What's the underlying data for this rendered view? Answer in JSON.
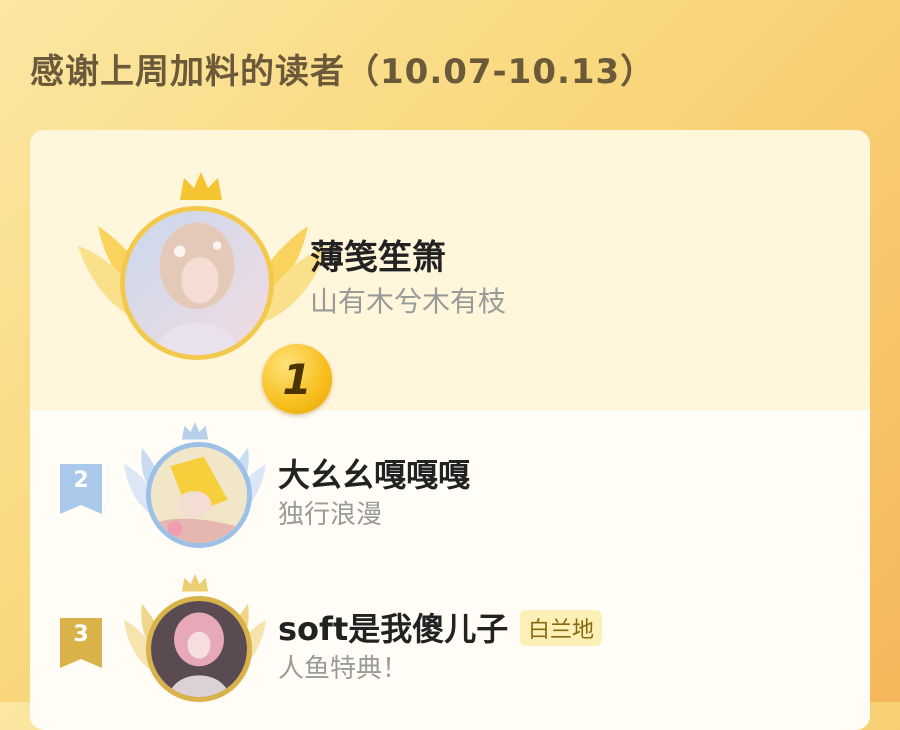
{
  "header": {
    "title": "感谢上周加料的读者（10.07-10.13）"
  },
  "ranking": [
    {
      "rank": "1",
      "name": "薄笺笙箫",
      "subtitle": "山有木兮木有枝"
    },
    {
      "rank": "2",
      "name": "大幺幺嘎嘎嘎",
      "subtitle": "独行浪漫"
    },
    {
      "rank": "3",
      "name": "soft是我傻儿子",
      "tag": "白兰地",
      "subtitle": "人鱼特典！"
    }
  ],
  "colors": {
    "gold": "#f7be1c",
    "silver": "#9dc1e6",
    "bronze": "#d9b24a",
    "background": "#f9d67a"
  }
}
